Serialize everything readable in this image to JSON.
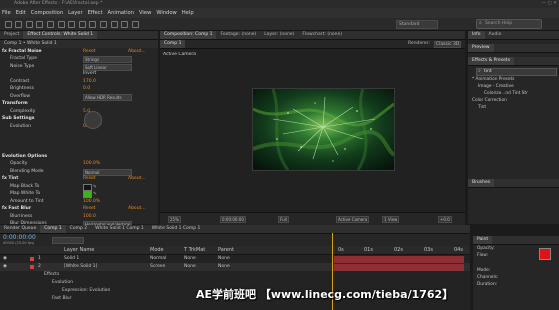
{
  "window": {
    "title": "Adobe After Effects - F:\\AE\\fractal.aep *"
  },
  "menu": [
    "File",
    "Edit",
    "Composition",
    "Layer",
    "Effect",
    "Animation",
    "View",
    "Window",
    "Help"
  ],
  "workspace": {
    "label": "Standard"
  },
  "search": {
    "placeholder": "Search Help"
  },
  "left_panel": {
    "tabs": [
      "Project",
      "Effect Controls: White Solid 1"
    ],
    "subtitle": "Comp 1 • White Solid 1",
    "rows": [
      {
        "kind": "hdr",
        "label": "fx Fractal Noise",
        "val": "Reset",
        "rt": "About..."
      },
      {
        "kind": "sel",
        "label": "Fractal Type",
        "val": "Strings"
      },
      {
        "kind": "sel",
        "label": "Noise Type",
        "val": "Soft Linear"
      },
      {
        "kind": "chk",
        "label": "",
        "val": "Invert"
      },
      {
        "kind": "val",
        "label": "Contrast",
        "val": "170.0"
      },
      {
        "kind": "val",
        "label": "Brightness",
        "val": "0.0"
      },
      {
        "kind": "sel",
        "label": "Overflow",
        "val": "Allow HDR Results"
      },
      {
        "kind": "hdr",
        "label": "Transform",
        "val": "",
        "rt": ""
      },
      {
        "kind": "val",
        "label": "Complexity",
        "val": "5.0"
      },
      {
        "kind": "hdr",
        "label": "Sub Settings",
        "val": "",
        "rt": ""
      },
      {
        "kind": "val",
        "label": "Evolution",
        "val": "0x+0.0°"
      },
      {
        "kind": "gap",
        "label": "",
        "val": ""
      },
      {
        "kind": "gap",
        "label": "",
        "val": ""
      },
      {
        "kind": "gap",
        "label": "",
        "val": ""
      },
      {
        "kind": "hdr",
        "label": "Evolution Options",
        "val": "",
        "rt": ""
      },
      {
        "kind": "val",
        "label": "Opacity",
        "val": "100.0%"
      },
      {
        "kind": "sel",
        "label": "Blending Mode",
        "val": "Normal"
      },
      {
        "kind": "hdr",
        "label": "fx Tint",
        "val": "Reset",
        "rt": "About..."
      },
      {
        "kind": "color",
        "label": "Map Black To",
        "val": "#141414"
      },
      {
        "kind": "color",
        "label": "Map White To",
        "val": "#3fb21f"
      },
      {
        "kind": "val",
        "label": "Amount to Tint",
        "val": "100.0%"
      },
      {
        "kind": "hdr",
        "label": "fx Fast Blur",
        "val": "Reset",
        "rt": "About..."
      },
      {
        "kind": "val",
        "label": "Blurriness",
        "val": "100.0"
      },
      {
        "kind": "sel",
        "label": "Blur Dimensions",
        "val": "Horizontal and Vertical"
      }
    ]
  },
  "viewer": {
    "tabs": [
      "Composition: Comp 1",
      "Footage: (none)",
      "Layer: (none)",
      "Flowchart: (none)"
    ],
    "comp_tab": "Comp 1",
    "camera_label": "Active Camera",
    "renderer_label": "Renderer:",
    "renderer_value": "Classic 3D",
    "footer": {
      "zoom": "25%",
      "timecode": "0:00:00:00",
      "quality": "Full",
      "camera": "Active Camera",
      "views": "1 View",
      "exposure": "+0.0"
    }
  },
  "right_panel": {
    "tabs": [
      "Info",
      "Audio"
    ],
    "preview_tab": "Preview",
    "effects_tab": "Effects & Presets",
    "search_value": "tint",
    "tree": [
      {
        "label": "* Animation Presets",
        "indent": 0
      },
      {
        "label": "Image - Creative",
        "indent": 1
      },
      {
        "label": "Colorize...nd Tint Str",
        "indent": 2
      },
      {
        "label": "Color Correction",
        "indent": 0
      },
      {
        "label": "Tint",
        "indent": 1
      }
    ],
    "brushes_tab": "Brushes"
  },
  "paint": {
    "tab": "Paint",
    "fg_color": "#e01212",
    "opacity_label": "Opacity:",
    "flow_label": "Flow:",
    "mode_label": "Mode:",
    "channels_label": "Channels:",
    "duration_label": "Duration:"
  },
  "timeline": {
    "tabs": [
      "Render Queue",
      "Comp 1",
      "Comp 2",
      "White Solid 1 Comp 1",
      "White Solid 1 Comp 1"
    ],
    "timecode": "0:00:00:00",
    "fps": "00000 (25.00 fps)",
    "columns": [
      "Layer Name",
      "Mode",
      "T TrkMat",
      "Parent"
    ],
    "layers": [
      {
        "num": "1",
        "name": "Solid 1",
        "mode": "Normal",
        "trk": "None",
        "parent": "None"
      },
      {
        "num": "2",
        "name": "[White Solid 1]",
        "mode": "Screen",
        "trk": "None",
        "parent": "None"
      }
    ],
    "sub_rows": [
      "Effects",
      "Evolution",
      "Expression: Evolution",
      "Fast Blur"
    ],
    "ruler": [
      "0s",
      "01s",
      "02s",
      "03s",
      "04s"
    ]
  },
  "watermark": "AE学前班吧 【www.linecg.com/tieba/1762】",
  "accent": {
    "orange": "#e08a2a",
    "timebar": "#8e2f36",
    "cti": "#d9a020"
  }
}
